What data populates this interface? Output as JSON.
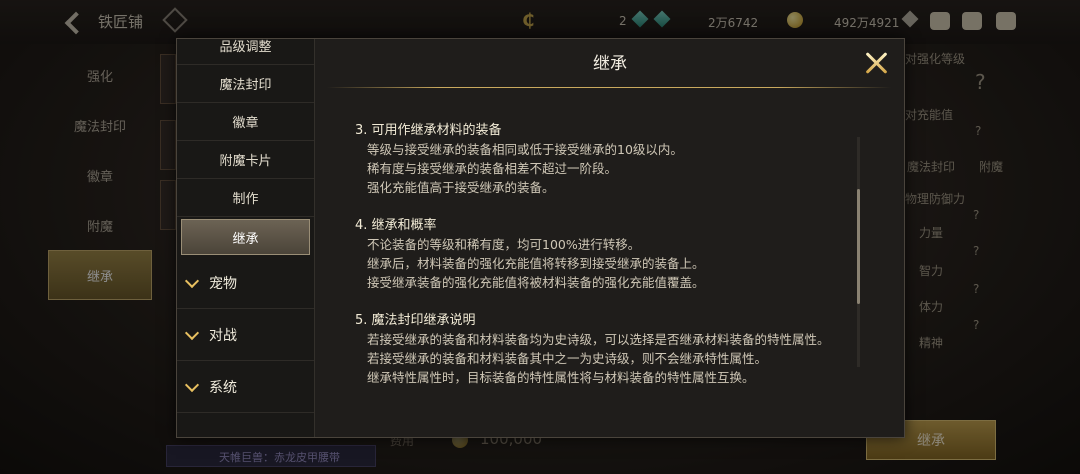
{
  "topbar": {
    "title": "铁匠铺",
    "stat_1": "2",
    "stat_2": "2万6742",
    "stat_3": "492万4921"
  },
  "leftnav": {
    "items": [
      "强化",
      "魔法封印",
      "徽章",
      "附魔",
      "继承"
    ],
    "active_index": 4
  },
  "background_right": {
    "label_1": "对强化等级",
    "label_2": "对充能值",
    "tab_1": "魔法封印",
    "tab_2": "附魔",
    "stat_labels": [
      "物理防御力",
      "力量",
      "智力",
      "体力",
      "精神"
    ],
    "unknown": "?",
    "action_button": "继承"
  },
  "background_bottom": {
    "item_name": "天帷巨兽：赤龙皮甲腰带",
    "fee_label": "费用",
    "fee_value": "100,000"
  },
  "help_modal": {
    "title": "继承",
    "sidebar": {
      "items": [
        "品级调整",
        "魔法封印",
        "徽章",
        "附魔卡片",
        "制作",
        "继承"
      ],
      "active_index": 5,
      "groups": [
        "宠物",
        "对战",
        "系统"
      ]
    },
    "sections": [
      {
        "heading": "3. 可用作继承材料的装备",
        "lines": [
          "等级与接受继承的装备相同或低于接受继承的10级以内。",
          "稀有度与接受继承的装备相差不超过一阶段。",
          "强化充能值高于接受继承的装备。"
        ]
      },
      {
        "heading": "4. 继承和概率",
        "lines": [
          "不论装备的等级和稀有度，均可100%进行转移。",
          "继承后，材料装备的强化充能值将转移到接受继承的装备上。",
          "接受继承装备的强化充能值将被材料装备的强化充能值覆盖。"
        ]
      },
      {
        "heading": "5. 魔法封印继承说明",
        "lines": [
          "若接受继承的装备和材料装备均为史诗级，可以选择是否继承材料装备的特性属性。",
          "若接受继承的装备和材料装备其中之一为史诗级，则不会继承特性属性。",
          "继承特性属性时，目标装备的特性属性将与材料装备的特性属性互换。"
        ]
      }
    ]
  }
}
